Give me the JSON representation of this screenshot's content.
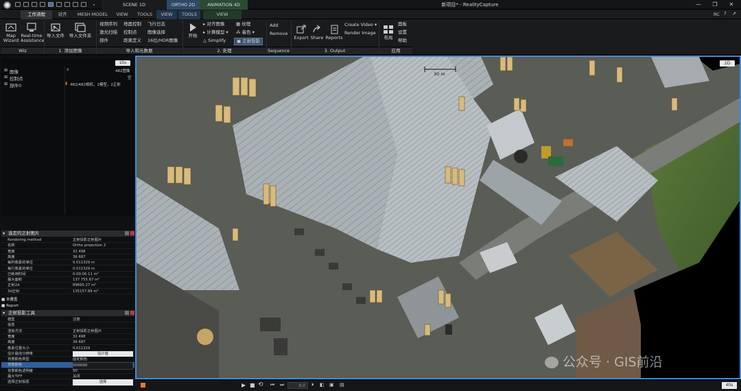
{
  "window": {
    "title": "新项目* - RealityCapture",
    "scene_tabs": [
      "SCENE 1D",
      "ORTHO 2D",
      "ANIMATION 4D"
    ],
    "controls": {
      "minimize": "—",
      "maximize": "❐",
      "close": "✕"
    },
    "account_label": "RC"
  },
  "menu": {
    "tabs": [
      "工作流程",
      "对齐",
      "MESH MODEL",
      "VIEW",
      "TOOLS",
      "VIEW",
      "TOOLS",
      "VIEW"
    ]
  },
  "ribbon": {
    "wiz": {
      "map_wizard": "Map\nWizard",
      "realtime": "Real-time\nAssistance",
      "label": "Wiz"
    },
    "add_images": {
      "import_file": "导入文件",
      "import_folder": "导入文件夹",
      "label": "1. 添加图像"
    },
    "import_meta": {
      "col1": [
        "视频序列",
        "激光扫描",
        "部件"
      ],
      "col2": [
        "地面控制",
        "控制点",
        "距离定义"
      ],
      "col3": [
        "飞行日志",
        "图像选择",
        "16位/HDR图像"
      ],
      "label": "导入和元数据"
    },
    "process": {
      "start": "开始",
      "align": "对齐图像",
      "calc_model": "计算模型",
      "simplify": "Simplify",
      "texture": "纹理",
      "colorize": "着色",
      "ortho": "正射投影",
      "label": "2. 处理"
    },
    "sequence": {
      "add": "Add",
      "remove": "Remove",
      "label": "Sequence"
    },
    "output": {
      "export": "Export",
      "share": "Share",
      "reports": "Reports",
      "create_video": "Create Video",
      "render_image": "Render Image",
      "label": "3. Output"
    },
    "app": {
      "layout": "布局",
      "panel": "面板",
      "settings": "设置",
      "help": "帮助",
      "label": "应用"
    }
  },
  "tree": {
    "badge": "1Ds",
    "items": [
      {
        "name": "图像",
        "count": "482图像"
      },
      {
        "name": "控制点",
        "count": "空"
      },
      {
        "name": "部件0",
        "count": "482/482相机，1模型，2正射"
      }
    ]
  },
  "ortho_panel": {
    "title": "选定的正射图片",
    "rows": [
      {
        "k": "Rendering method",
        "v": "正射投影正射图片"
      },
      {
        "k": "名称",
        "v": "Ortho projection 2"
      },
      {
        "k": "宽度",
        "v": "32 498"
      },
      {
        "k": "高度",
        "v": "36 687"
      },
      {
        "k": "每列像素的单位",
        "v": "0.011329 m"
      },
      {
        "k": "每行像素的单位",
        "v": "0.011329 m"
      },
      {
        "k": "已耗用时间",
        "v": "0:00:00.11 m²"
      },
      {
        "k": "最大面积",
        "v": "137 755.67 m²"
      },
      {
        "k": "正射2d",
        "v": "89695.27 m²"
      },
      {
        "k": "3d正射",
        "v": "135157.89 m²"
      }
    ],
    "subs": [
      "未覆盖",
      "Report"
    ]
  },
  "tool_panel": {
    "title": "正射投影工具",
    "rows": [
      {
        "k": "模型",
        "v": "注意"
      },
      {
        "k": "信息",
        "v": ""
      },
      {
        "k": "渲染方法",
        "v": "正射投影正射图片"
      },
      {
        "k": "宽度",
        "v": "32 498"
      },
      {
        "k": "高度",
        "v": "36 687"
      },
      {
        "k": "像素位置大小",
        "v": "0.011329"
      },
      {
        "k": "估计最佳分辨率",
        "v": "估计值"
      },
      {
        "k": "背景颜色类型",
        "v": "固定颜色"
      },
      {
        "k": "背景颜色",
        "v": "000000"
      },
      {
        "k": "背景颜色透明度",
        "v": "50"
      },
      {
        "k": "最大TIFF",
        "v": "关闭"
      },
      {
        "k": "选择正射投影",
        "v": "选择"
      }
    ]
  },
  "viewport": {
    "mode": "2D",
    "scale_label": "30 m",
    "watermark": "公众号 · GIS前沿"
  },
  "timeline": {
    "time": "0.0",
    "zoom": "40s"
  }
}
